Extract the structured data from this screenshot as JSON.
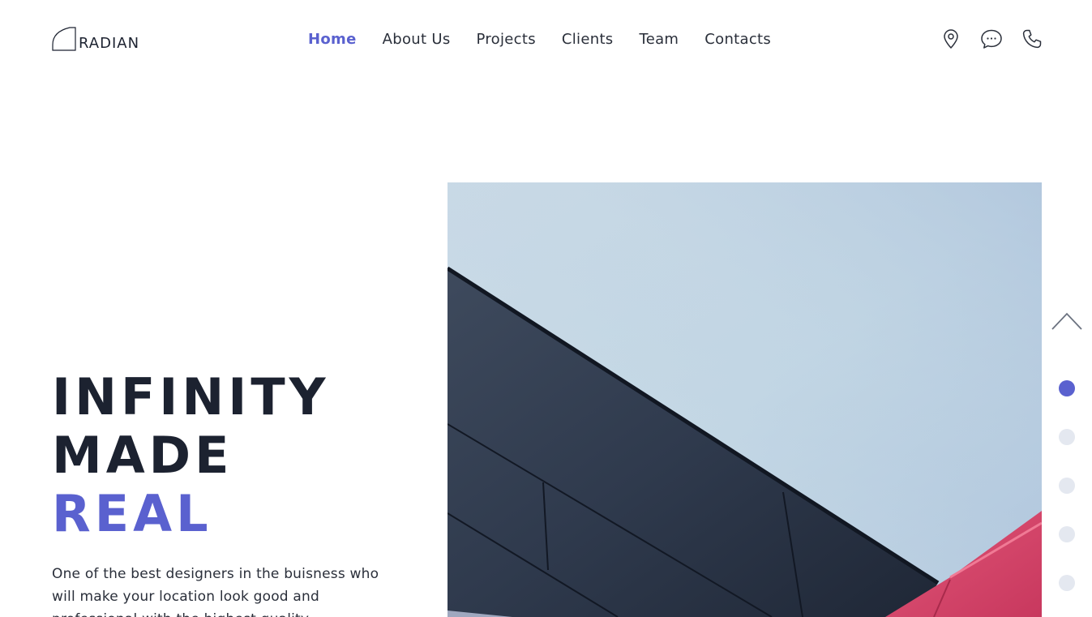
{
  "brand": {
    "name": "RADIAN"
  },
  "nav": {
    "items": [
      {
        "label": "Home",
        "active": true
      },
      {
        "label": "About Us",
        "active": false
      },
      {
        "label": "Projects",
        "active": false
      },
      {
        "label": "Clients",
        "active": false
      },
      {
        "label": "Team",
        "active": false
      },
      {
        "label": "Contacts",
        "active": false
      }
    ]
  },
  "header_icons": [
    "location-pin-icon",
    "chat-bubble-icon",
    "phone-icon"
  ],
  "hero": {
    "title_line1": "INFINITY",
    "title_line2": "MADE",
    "title_line3": "REAL",
    "description": "One of the best designers in the buisness who will make your location look good and professional with the highest quality."
  },
  "slider": {
    "dot_count": 5,
    "active_index": 0
  },
  "colors": {
    "accent": "#5a61cf",
    "text_dark": "#1c2230",
    "dot_inactive": "#e4e8f0"
  }
}
